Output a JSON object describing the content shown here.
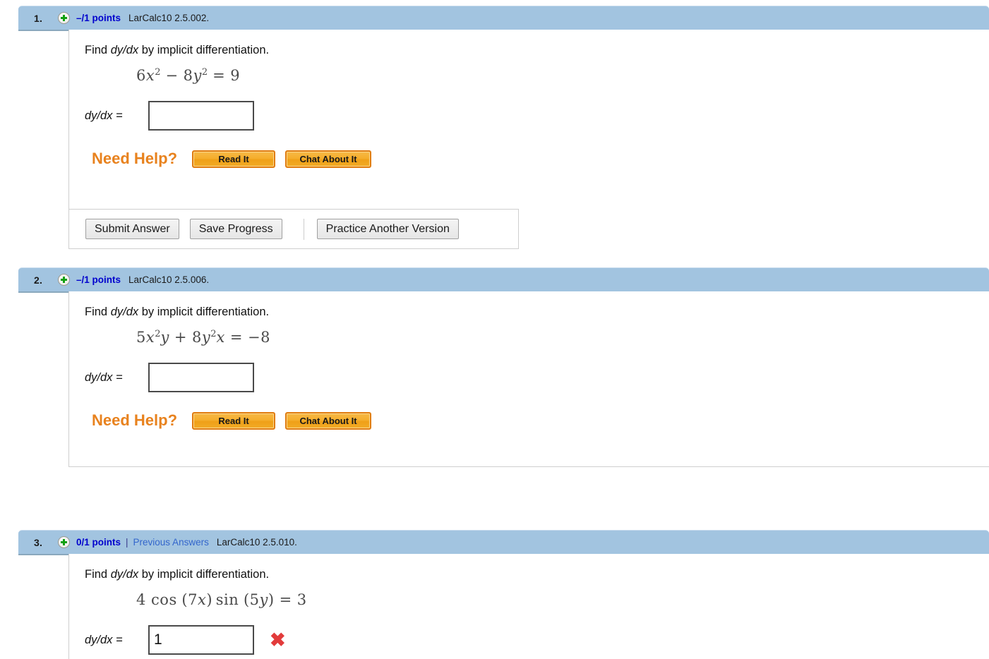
{
  "page": {
    "title": "Implicit Differentiation Homework",
    "accent_header_color": "#a2c4e0",
    "points_color": "#0000cd",
    "link_color": "#3366cc",
    "need_help_color": "#e8821e",
    "incorrect_color": "#e23b3b"
  },
  "questions": [
    {
      "number": "1.",
      "toggle_icon": "plus-circle-icon",
      "points": "–/1 points",
      "previous_answers_separator": "",
      "previous_answers": "",
      "code": "LarCalc10 2.5.002.",
      "prompt_prefix": "Find ",
      "prompt_italic": "dy/dx",
      "prompt_suffix": " by implicit differentiation.",
      "equation": {
        "text": "6x² − 8y² = 9",
        "tokens": [
          {
            "t": "6x",
            "sup": "2"
          },
          {
            "t": "−",
            "op": true
          },
          {
            "t": "8y",
            "sup": "2"
          },
          {
            "t": "=",
            "op": true
          },
          {
            "t": "9"
          }
        ]
      },
      "answer_label": "dy/dx =",
      "answer_value": "",
      "answer_placeholder": "",
      "graded": false,
      "grade_mark": "",
      "need_help_label": "Need Help?",
      "read_it_label": "Read It",
      "chat_label": "Chat About It",
      "has_submit_bar": true,
      "submit_label": "Submit Answer",
      "save_label": "Save Progress",
      "practice_label": "Practice Another Version"
    },
    {
      "number": "2.",
      "toggle_icon": "plus-circle-icon",
      "points": "–/1 points",
      "previous_answers_separator": "",
      "previous_answers": "",
      "code": "LarCalc10 2.5.006.",
      "prompt_prefix": "Find ",
      "prompt_italic": "dy/dx",
      "prompt_suffix": " by implicit differentiation.",
      "equation": {
        "text": "5x²y + 8y²x = −8",
        "tokens": [
          {
            "t": "5x",
            "sup": "2",
            "after": "y"
          },
          {
            "t": "+",
            "op": true
          },
          {
            "t": "8y",
            "sup": "2",
            "after": "x"
          },
          {
            "t": "=",
            "op": true
          },
          {
            "t": "−8"
          }
        ]
      },
      "answer_label": "dy/dx =",
      "answer_value": "",
      "answer_placeholder": "",
      "graded": false,
      "grade_mark": "",
      "need_help_label": "Need Help?",
      "read_it_label": "Read It",
      "chat_label": "Chat About It",
      "has_submit_bar": false,
      "submit_label": "",
      "save_label": "",
      "practice_label": ""
    },
    {
      "number": "3.",
      "toggle_icon": "plus-circle-icon",
      "points": "0/1 points",
      "previous_answers_separator": "|",
      "previous_answers": "Previous Answers",
      "code": "LarCalc10 2.5.010.",
      "prompt_prefix": "Find ",
      "prompt_italic": "dy/dx",
      "prompt_suffix": " by implicit differentiation.",
      "equation": {
        "text": "4 cos (7x) sin (5y) = 3",
        "tokens": [
          {
            "t": "4 cos (7x) sin (5y)"
          },
          {
            "t": "=",
            "op": true
          },
          {
            "t": "3"
          }
        ]
      },
      "answer_label": "dy/dx =",
      "answer_value": "1",
      "answer_placeholder": "",
      "graded": true,
      "grade_mark": "✖",
      "need_help_label": "",
      "read_it_label": "",
      "chat_label": "",
      "has_submit_bar": false,
      "submit_label": "",
      "save_label": "",
      "practice_label": ""
    }
  ]
}
